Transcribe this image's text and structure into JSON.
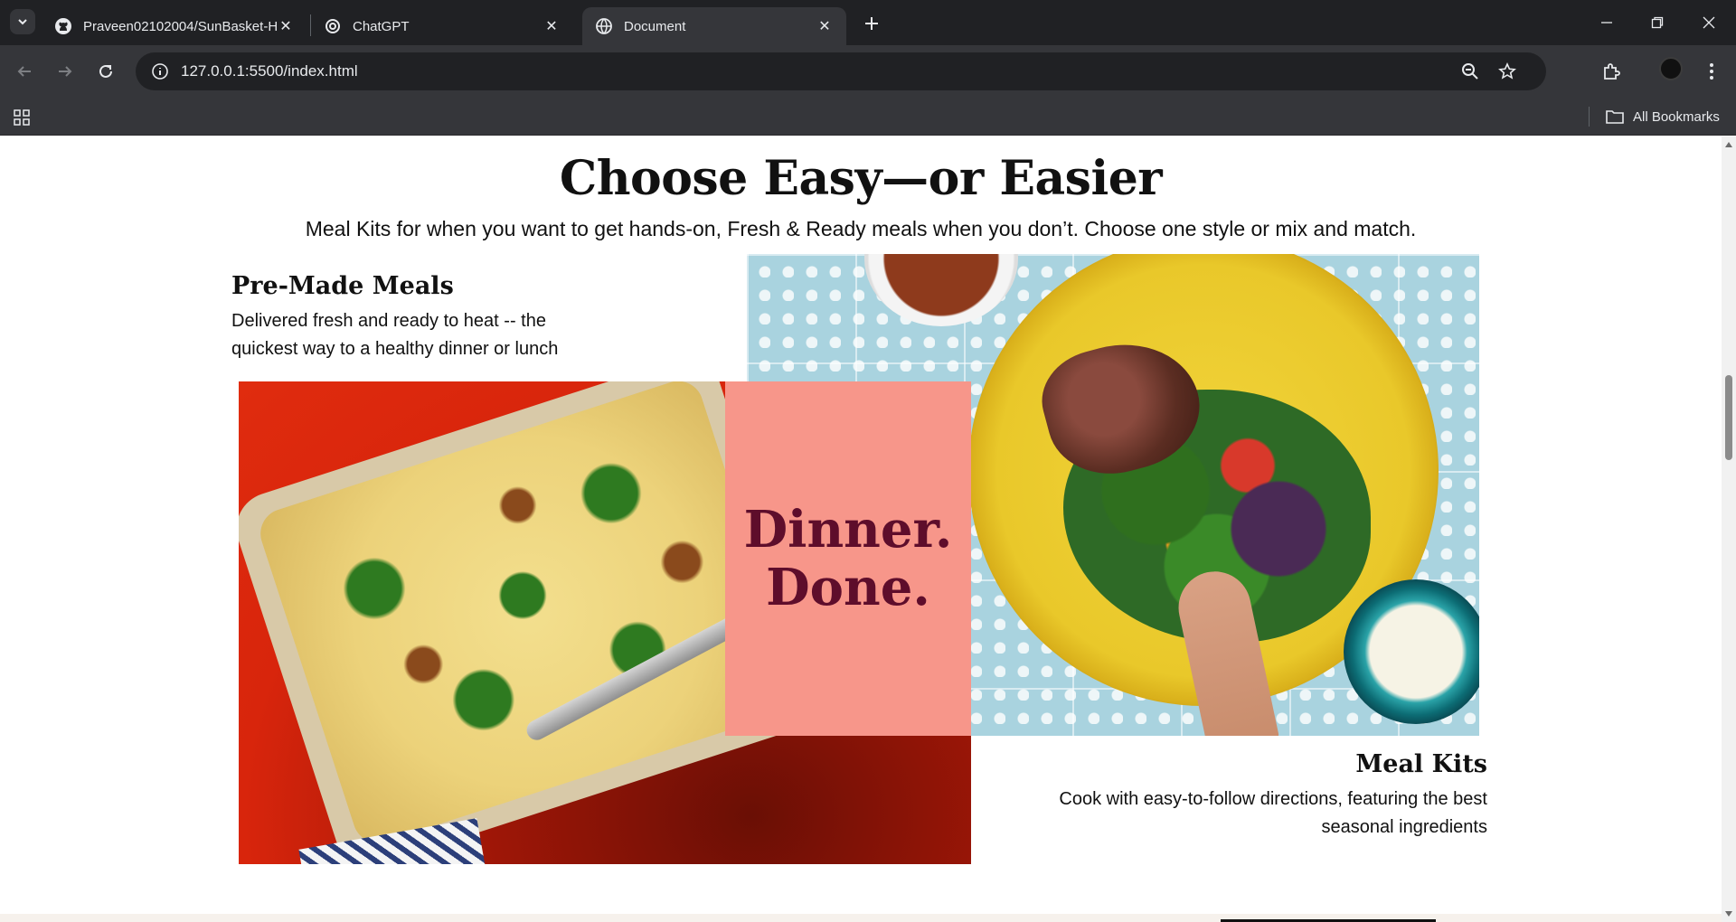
{
  "browser": {
    "tabs": [
      {
        "title": "Praveen02102004/SunBasket-H",
        "icon": "github-icon"
      },
      {
        "title": "ChatGPT",
        "icon": "chatgpt-icon"
      },
      {
        "title": "Document",
        "icon": "globe-icon",
        "active": true
      }
    ],
    "url": "127.0.0.1:5500/index.html",
    "bookmarks_label": "All Bookmarks"
  },
  "page": {
    "title": "Choose Easy—or Easier",
    "subtitle": "Meal Kits for when you want to get hands-on, Fresh & Ready meals when you don’t. Choose one style or mix and match.",
    "premade": {
      "heading": "Pre-Made Meals",
      "description": "Delivered fresh and ready to heat -- the quickest way to a healthy dinner or lunch"
    },
    "mealkits": {
      "heading": "Meal Kits",
      "description": "Cook with easy-to-follow directions, featuring the best seasonal ingredients"
    },
    "panel": {
      "line1": "Dinner.",
      "line2": "Done."
    }
  },
  "colors": {
    "panel_bg": "#f7968a",
    "panel_text": "#5e0d2b"
  }
}
